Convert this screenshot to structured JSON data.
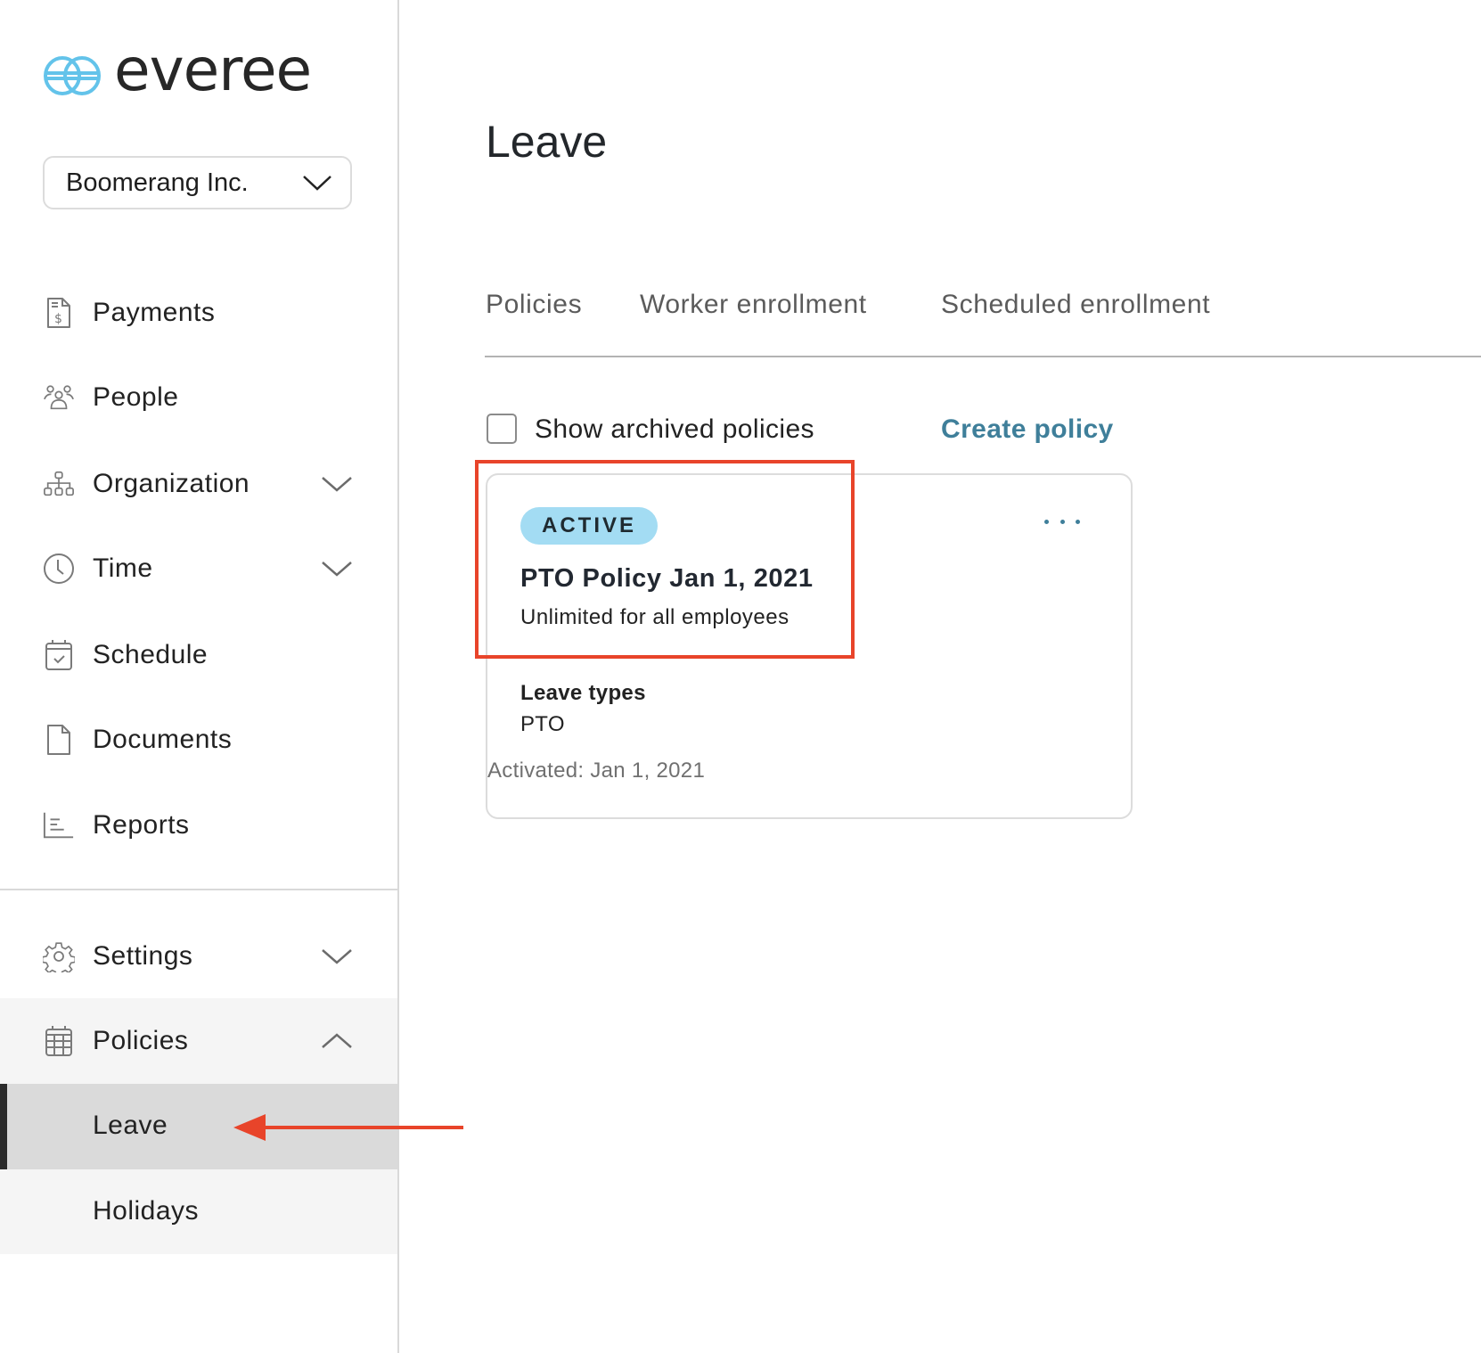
{
  "app": {
    "brand": "everee",
    "brand_color": "#63c3ea",
    "accent_color": "#3f7f9a",
    "annotation_color": "#e8442a"
  },
  "company_select": {
    "value": "Boomerang Inc.",
    "icon": "chevron-down-icon"
  },
  "sidebar": {
    "items": [
      {
        "label": "Payments",
        "icon": "payments-doc-icon",
        "expandable": false
      },
      {
        "label": "People",
        "icon": "people-icon",
        "expandable": false
      },
      {
        "label": "Organization",
        "icon": "org-chart-icon",
        "expandable": true,
        "expanded": false
      },
      {
        "label": "Time",
        "icon": "clock-icon",
        "expandable": true,
        "expanded": false
      },
      {
        "label": "Schedule",
        "icon": "calendar-check-icon",
        "expandable": false
      },
      {
        "label": "Documents",
        "icon": "document-icon",
        "expandable": false
      },
      {
        "label": "Reports",
        "icon": "reports-icon",
        "expandable": false
      }
    ],
    "bottom_items": [
      {
        "label": "Settings",
        "icon": "gear-icon",
        "expandable": true,
        "expanded": false
      },
      {
        "label": "Policies",
        "icon": "calendar-grid-icon",
        "expandable": true,
        "expanded": true,
        "children": [
          {
            "label": "Leave",
            "active": true
          },
          {
            "label": "Holidays",
            "active": false
          }
        ]
      }
    ]
  },
  "main": {
    "title": "Leave",
    "tabs": [
      {
        "label": "Policies"
      },
      {
        "label": "Worker enrollment"
      },
      {
        "label": "Scheduled enrollment"
      }
    ],
    "show_archived": {
      "label": "Show archived policies",
      "checked": false
    },
    "create_policy_label": "Create policy",
    "policy_card": {
      "status": "ACTIVE",
      "status_color": "#a3dcf3",
      "title": "PTO Policy Jan 1, 2021",
      "subtitle": "Unlimited for all employees",
      "leave_types_label": "Leave types",
      "leave_types_value": "PTO",
      "activated": "Activated: Jan 1, 2021",
      "menu_icon": "more-horizontal-icon"
    }
  }
}
